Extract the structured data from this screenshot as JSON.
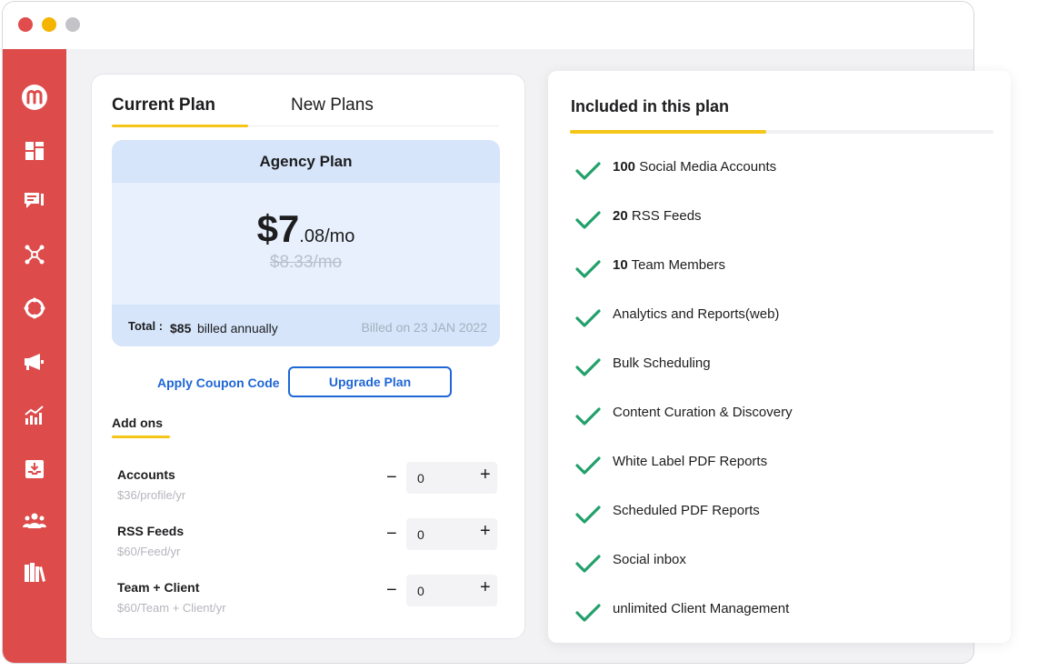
{
  "sidebar": {
    "icons": [
      "logo-icon",
      "dashboard-icon",
      "compose-icon",
      "network-icon",
      "lifebuoy-icon",
      "megaphone-icon",
      "analytics-icon",
      "inbox-icon",
      "team-icon",
      "library-icon"
    ]
  },
  "plan_card": {
    "tabs": [
      {
        "label": "Current Plan"
      },
      {
        "label": "New Plans"
      }
    ],
    "plan_name": "Agency Plan",
    "price_main": "$7",
    "price_suffix": ".08/mo",
    "old_price": "$8.33/mo",
    "total_label": "Total :",
    "total_amount": "$85",
    "total_suffix": "billed annually",
    "billed_on": "Billed on 23 JAN 2022",
    "coupon_label": "Apply Coupon Code",
    "upgrade_label": "Upgrade Plan",
    "addons_title": "Add ons",
    "addons": [
      {
        "name": "Accounts",
        "price": "$36/profile/yr",
        "qty": "0"
      },
      {
        "name": "RSS Feeds",
        "price": "$60/Feed/yr",
        "qty": "0"
      },
      {
        "name": "Team + Client",
        "price": "$60/Team + Client/yr",
        "qty": "0"
      }
    ],
    "minus_symbol": "−",
    "plus_symbol": "+"
  },
  "included": {
    "title": "Included in this plan",
    "features": [
      {
        "bold": "100",
        "text": "Social Media Accounts"
      },
      {
        "bold": "20",
        "text": "RSS Feeds"
      },
      {
        "bold": "10",
        "text": "Team Members"
      },
      {
        "bold": "",
        "text": "Analytics and Reports(web)"
      },
      {
        "bold": "",
        "text": "Bulk Scheduling"
      },
      {
        "bold": "",
        "text": "Content Curation & Discovery"
      },
      {
        "bold": "",
        "text": "White Label PDF Reports"
      },
      {
        "bold": "",
        "text": "Scheduled PDF Reports"
      },
      {
        "bold": "",
        "text": "Social inbox"
      },
      {
        "bold": "",
        "text": "unlimited Client Management"
      }
    ]
  },
  "colors": {
    "sidebar": "#dd4b4b",
    "accent_yellow": "#f5c518",
    "link_blue": "#1f66d6",
    "check_green": "#22a06b",
    "plan_bg": "#e7f0fc"
  }
}
